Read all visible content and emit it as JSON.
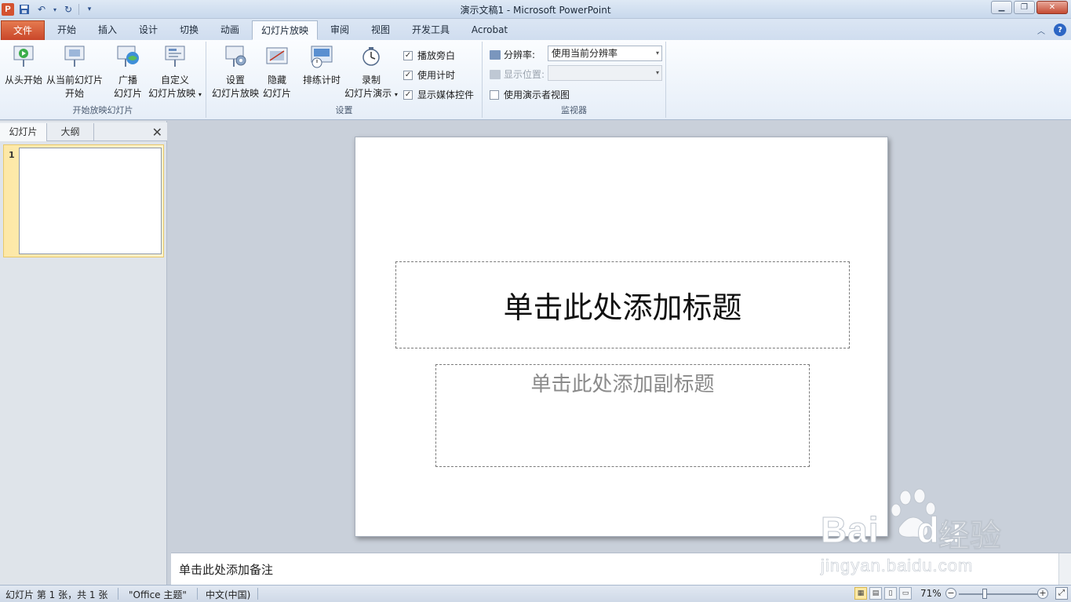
{
  "window": {
    "title": "演示文稿1 - Microsoft PowerPoint",
    "app_logo": "P"
  },
  "tabs": [
    {
      "label": "文件"
    },
    {
      "label": "开始"
    },
    {
      "label": "插入"
    },
    {
      "label": "设计"
    },
    {
      "label": "切换"
    },
    {
      "label": "动画"
    },
    {
      "label": "幻灯片放映"
    },
    {
      "label": "审阅"
    },
    {
      "label": "视图"
    },
    {
      "label": "开发工具"
    },
    {
      "label": "Acrobat"
    }
  ],
  "active_tab": "幻灯片放映",
  "ribbon": {
    "start_group": {
      "label": "开始放映幻灯片",
      "from_beginning": "从头开始",
      "from_current_l1": "从当前幻灯片",
      "from_current_l2": "开始",
      "broadcast_l1": "广播",
      "broadcast_l2": "幻灯片",
      "custom_l1": "自定义",
      "custom_l2": "幻灯片放映"
    },
    "setup_group": {
      "label": "设置",
      "setup_show_l1": "设置",
      "setup_show_l2": "幻灯片放映",
      "hide_slide_l1": "隐藏",
      "hide_slide_l2": "幻灯片",
      "rehearse": "排练计时",
      "record_l1": "录制",
      "record_l2": "幻灯片演示",
      "play_narrations": "播放旁白",
      "use_timings": "使用计时",
      "show_media_controls": "显示媒体控件"
    },
    "monitors_group": {
      "label": "监视器",
      "resolution_label": "分辨率:",
      "resolution_value": "使用当前分辨率",
      "show_on_label": "显示位置:",
      "presenter_view": "使用演示者视图"
    }
  },
  "left_pane": {
    "tab_slides": "幻灯片",
    "tab_outline": "大纲",
    "close": "✕",
    "slide_number": "1"
  },
  "slide": {
    "title_placeholder": "单击此处添加标题",
    "subtitle_placeholder": "单击此处添加副标题"
  },
  "notes": {
    "placeholder": "单击此处添加备注"
  },
  "status": {
    "slide_info": "幻灯片 第 1 张，共 1 张",
    "theme": "\"Office 主题\"",
    "language": "中文(中国)",
    "zoom": "71%",
    "zoom_minus": "−",
    "zoom_plus": "+"
  },
  "watermark": {
    "brand": "Bai",
    "brand2": "du",
    "cn": "经验",
    "url": "jingyan.baidu.com"
  }
}
